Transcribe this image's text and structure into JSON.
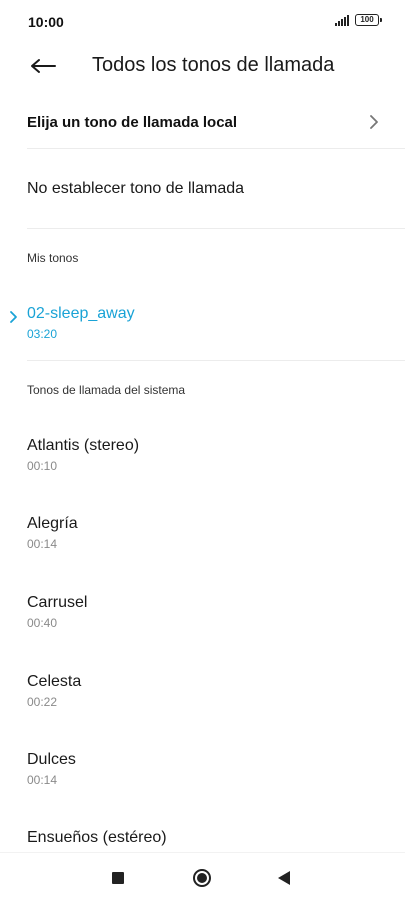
{
  "status_bar": {
    "time": "10:00",
    "battery": "100"
  },
  "header": {
    "title": "Todos los tonos de llamada"
  },
  "local_tone": {
    "label": "Elija un tono de llamada local"
  },
  "no_tone": {
    "label": "No establecer tono de llamada"
  },
  "my_tones": {
    "header": "Mis tonos",
    "items": [
      {
        "name": "02-sleep_away",
        "duration": "03:20",
        "selected": true
      }
    ]
  },
  "system_tones": {
    "header": "Tonos de llamada del sistema",
    "items": [
      {
        "name": "Atlantis (stereo)",
        "duration": "00:10"
      },
      {
        "name": "Alegría",
        "duration": "00:14"
      },
      {
        "name": "Carrusel",
        "duration": "00:40"
      },
      {
        "name": "Celesta",
        "duration": "00:22"
      },
      {
        "name": "Dulces",
        "duration": "00:14"
      }
    ],
    "partial_item": {
      "name": "Ensueños (estéreo)"
    }
  },
  "colors": {
    "accent": "#1aa3d6",
    "secondary_text": "#8a8a8a"
  },
  "icons": {
    "back": "arrow-left-icon",
    "chevron": "chevron-right-icon",
    "selected": "chevron-right-icon",
    "signal": "signal-icon",
    "battery": "battery-icon"
  }
}
